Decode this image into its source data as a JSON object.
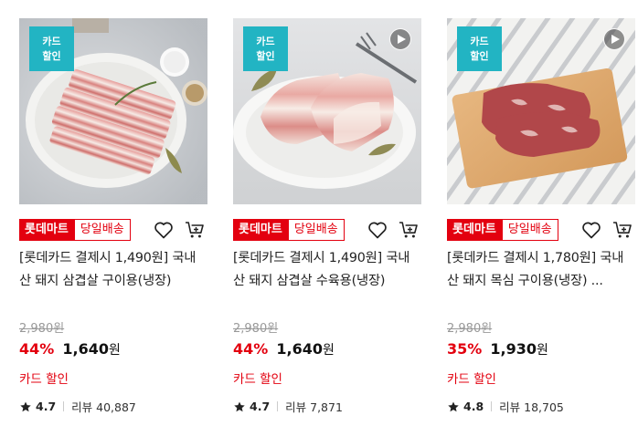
{
  "products": [
    {
      "card_badge": [
        "카드",
        "할인"
      ],
      "has_video": false,
      "store_badge": "롯데마트",
      "delivery_badge": "당일배송",
      "title": "[롯데카드 결제시 1,490원] 국내산 돼지 삼겹살 구이용(냉장)",
      "original_price": "2,980원",
      "discount": "44%",
      "price": "1,640",
      "currency": "원",
      "card_discount": "카드 할인",
      "rating": "4.7",
      "reviews": "리뷰 40,887",
      "icon_star": "star-icon",
      "icon_heart": "heart-icon",
      "icon_cart": "cart-icon"
    },
    {
      "card_badge": [
        "카드",
        "할인"
      ],
      "has_video": true,
      "store_badge": "롯데마트",
      "delivery_badge": "당일배송",
      "title": "[롯데카드 결제시 1,490원] 국내산 돼지 삼겹살 수육용(냉장)",
      "original_price": "2,980원",
      "discount": "44%",
      "price": "1,640",
      "currency": "원",
      "card_discount": "카드 할인",
      "rating": "4.7",
      "reviews": "리뷰 7,871",
      "icon_star": "star-icon",
      "icon_heart": "heart-icon",
      "icon_cart": "cart-icon"
    },
    {
      "card_badge": [
        "카드",
        "할인"
      ],
      "has_video": true,
      "store_badge": "롯데마트",
      "delivery_badge": "당일배송",
      "title": "[롯데카드 결제시 1,780원] 국내산 돼지 목심 구이용(냉장) ...",
      "original_price": "2,980원",
      "discount": "35%",
      "price": "1,930",
      "currency": "원",
      "card_discount": "카드 할인",
      "rating": "4.8",
      "reviews": "리뷰 18,705",
      "icon_star": "star-icon",
      "icon_heart": "heart-icon",
      "icon_cart": "cart-icon"
    }
  ],
  "colors": {
    "accent_red": "#e3000f",
    "card_badge_teal": "#22b4c3",
    "strikethrough_gray": "#999999"
  }
}
